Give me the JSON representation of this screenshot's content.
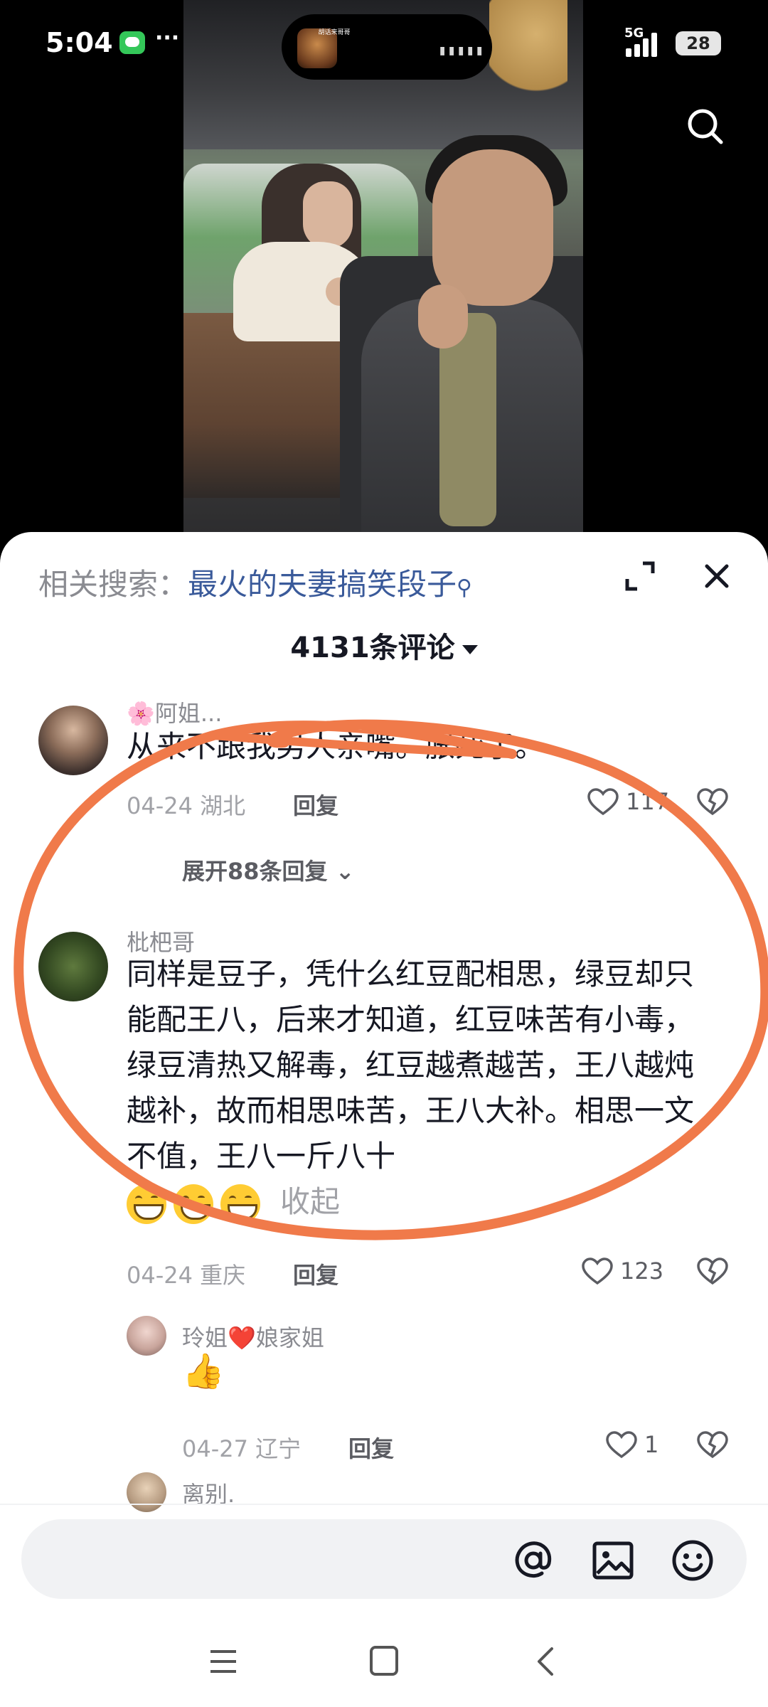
{
  "status_bar": {
    "time": "5:04",
    "more": "···",
    "network": "5G",
    "battery": "28",
    "island_title": "胡话来哥哥"
  },
  "video": {
    "search_icon": "search-icon"
  },
  "comments_panel": {
    "related_label": "相关搜索：",
    "related_keyword": "最火的夫妻搞笑段子",
    "count_label": "4131条评论",
    "expand_icon": "expand-icon",
    "close_icon": "close-icon"
  },
  "comments": [
    {
      "username": "🌸阿姐...",
      "text": "从来不跟我男人亲嘴。胀死了。",
      "date": "04-24",
      "location": "湖北",
      "reply_label": "回复",
      "likes": "117",
      "expand_replies": "展开88条回复"
    },
    {
      "username": "枇杷哥",
      "text": "同样是豆子，凭什么红豆配相思，绿豆却只能配王八，后来才知道，红豆味苦有小毒，绿豆清热又解毒，红豆越煮越苦，王八越炖越补，故而相思味苦，王八大补。相思一文不值，王八一斤八十",
      "collapse_label": "收起",
      "date": "04-24",
      "location": "重庆",
      "reply_label": "回复",
      "likes": "123"
    },
    {
      "username": "玲姐❤️娘家姐",
      "text": "👍",
      "date": "04-27",
      "location": "辽宁",
      "reply_label": "回复",
      "likes": "1"
    },
    {
      "username": "离别."
    }
  ],
  "input_bar": {
    "placeholder": "",
    "icons": [
      "at-icon",
      "image-icon",
      "emoji-icon"
    ]
  },
  "nav_bar": {
    "icons": [
      "menu-icon",
      "home-icon",
      "back-icon"
    ]
  },
  "colors": {
    "annotation": "#f07a4a",
    "link": "#3a5a9a",
    "muted": "#a1a2a7"
  }
}
